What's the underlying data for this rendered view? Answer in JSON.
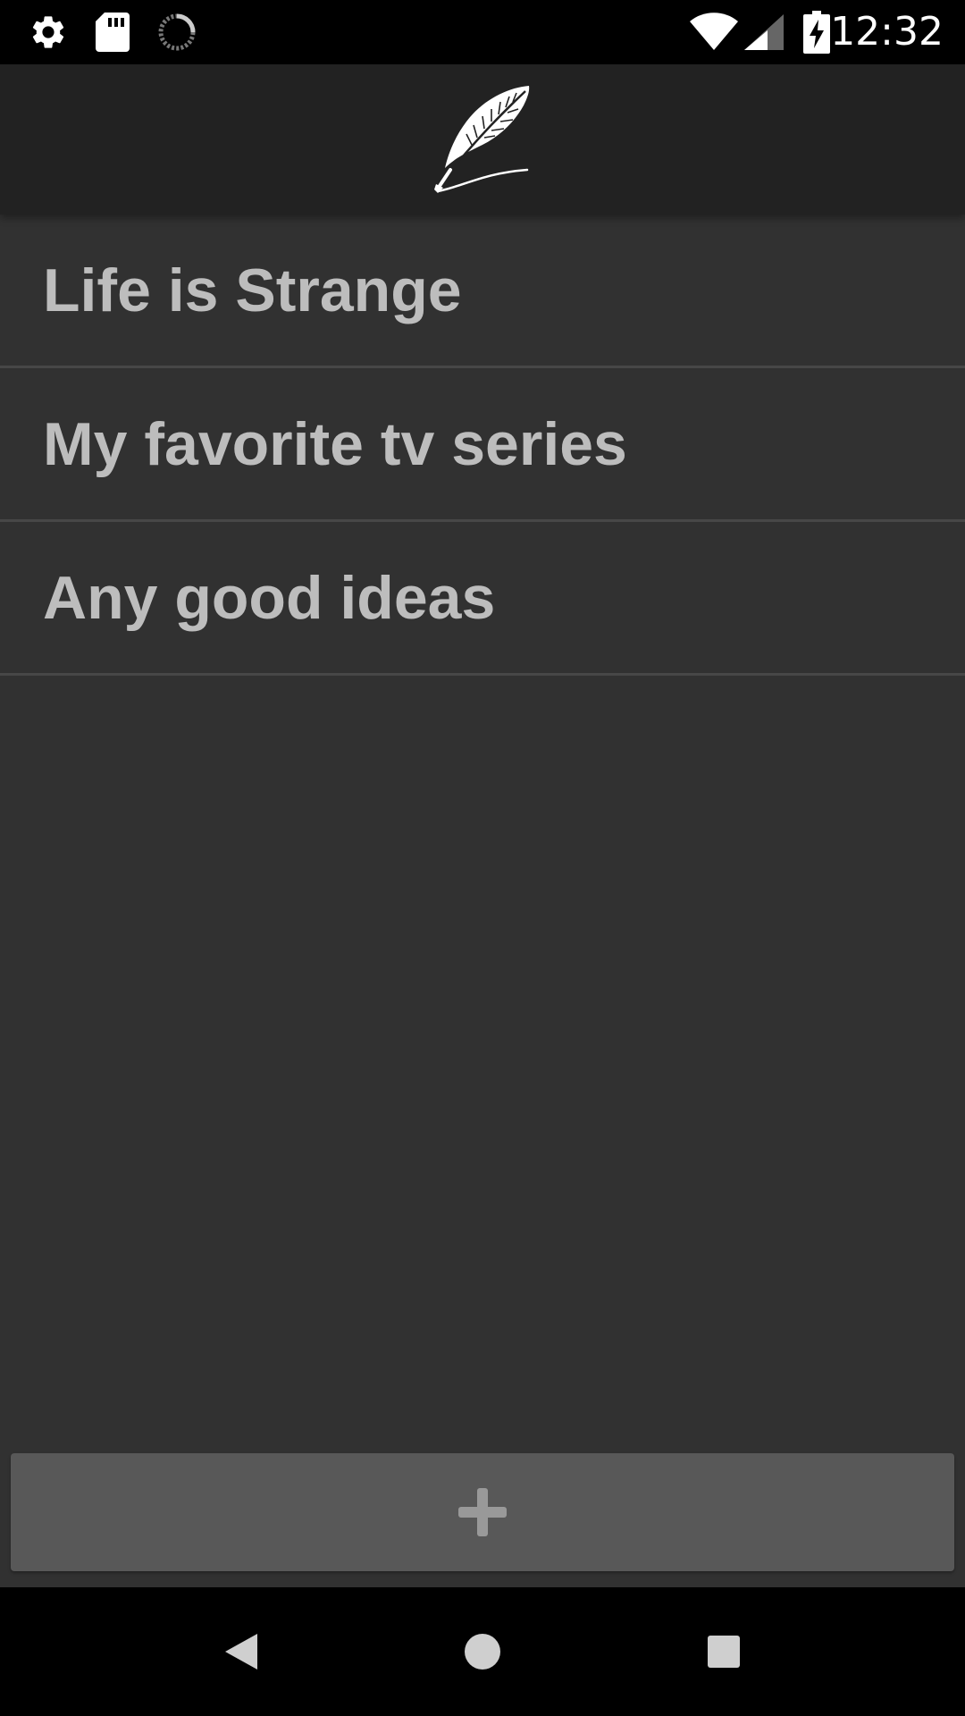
{
  "status_bar": {
    "time": "12:32",
    "left_icons": [
      "settings-icon",
      "sd-card-icon",
      "sync-progress-icon"
    ],
    "right_icons": [
      "wifi-icon",
      "cellular-signal-icon",
      "battery-charging-icon"
    ]
  },
  "app_bar": {
    "logo": "feather-quill-icon"
  },
  "notes": [
    {
      "title": "Life is Strange"
    },
    {
      "title": "My favorite tv series"
    },
    {
      "title": "Any good ideas"
    }
  ],
  "add_button": {
    "icon": "plus-icon"
  },
  "nav_bar": {
    "buttons": [
      "back-icon",
      "home-icon",
      "recents-icon"
    ]
  },
  "colors": {
    "background": "#313131",
    "app_bar": "#222222",
    "divider": "#474747",
    "text": "#bdbdbd",
    "button": "#585858"
  }
}
